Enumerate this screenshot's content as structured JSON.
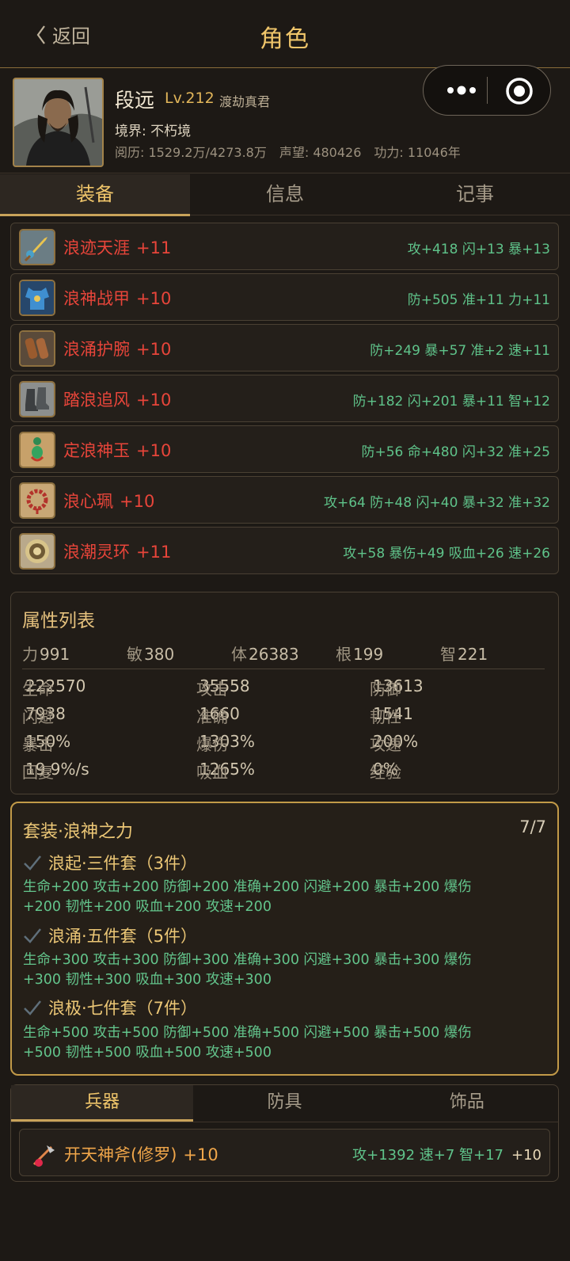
{
  "nav": {
    "back": "返回",
    "title": "角色"
  },
  "profile": {
    "name": "段远",
    "level": "Lv.212",
    "rank": "渡劫真君",
    "realm": "境界: 不朽境",
    "experience": "阅历: 1529.2万/4273.8万",
    "reputation": "声望: 480426",
    "power": "功力: 11046年"
  },
  "tabs": [
    "装备",
    "信息",
    "记事"
  ],
  "equipment": [
    {
      "name": "浪迹天涯",
      "plus": "+11",
      "attrs": "攻+418 闪+13 暴+13",
      "icon": "sword-icon"
    },
    {
      "name": "浪神战甲",
      "plus": "+10",
      "attrs": "防+505 准+11 力+11",
      "icon": "armor-icon"
    },
    {
      "name": "浪涌护腕",
      "plus": "+10",
      "attrs": "防+249 暴+57 准+2 速+11",
      "icon": "bracer-icon"
    },
    {
      "name": "踏浪追风",
      "plus": "+10",
      "attrs": "防+182 闪+201 暴+11 智+12",
      "icon": "boots-icon"
    },
    {
      "name": "定浪神玉",
      "plus": "+10",
      "attrs": "防+56 命+480 闪+32 准+25",
      "icon": "jade-pendant-icon"
    },
    {
      "name": "浪心珮",
      "plus": "+10",
      "attrs": "攻+64 防+48 闪+40 暴+32 准+32",
      "icon": "bead-necklace-icon"
    },
    {
      "name": "浪潮灵环",
      "plus": "+11",
      "attrs": "攻+58 暴伤+49 吸血+26 速+26",
      "icon": "ring-icon"
    }
  ],
  "attributes": {
    "title": "属性列表",
    "primary": [
      {
        "label": "力",
        "value": "991"
      },
      {
        "label": "敏",
        "value": "380"
      },
      {
        "label": "体",
        "value": "26383"
      },
      {
        "label": "根",
        "value": "199"
      },
      {
        "label": "智",
        "value": "221"
      }
    ],
    "secondary": [
      {
        "label": "生命",
        "value": "222570"
      },
      {
        "label": "攻击",
        "value": "35558"
      },
      {
        "label": "防御",
        "value": "13613"
      },
      {
        "label": "闪避",
        "value": "7938"
      },
      {
        "label": "准确",
        "value": "1660"
      },
      {
        "label": "韧性",
        "value": "1541"
      },
      {
        "label": "暴击",
        "value": "150%"
      },
      {
        "label": "爆伤",
        "value": "1303%"
      },
      {
        "label": "攻速",
        "value": "200%"
      },
      {
        "label": "回复",
        "value": "19.9%/s"
      },
      {
        "label": "吸血",
        "value": "1265%"
      },
      {
        "label": "经验",
        "value": "0%"
      }
    ]
  },
  "set": {
    "title": "套装·浪神之力",
    "count": "7/7",
    "tiers": [
      {
        "name": "浪起·三件套（3件）",
        "effects": "生命+200  攻击+200  防御+200  准确+200  闪避+200  暴击+200  爆伤+200  韧性+200  吸血+200  攻速+200"
      },
      {
        "name": "浪涌·五件套（5件）",
        "effects": "生命+300  攻击+300  防御+300  准确+300  闪避+300  暴击+300  爆伤+300  韧性+300  吸血+300  攻速+300"
      },
      {
        "name": "浪极·七件套（7件）",
        "effects": "生命+500  攻击+500  防御+500  准确+500  闪避+500  暴击+500  爆伤+500  韧性+500  吸血+500  攻速+500"
      }
    ]
  },
  "subtabs": [
    "兵器",
    "防具",
    "饰品"
  ],
  "weapon": {
    "name": "开天神斧(修罗)",
    "plus": "+10",
    "attrs": "攻+1392 速+7 智+17",
    "extra": "+10"
  },
  "colors": {
    "accent": "#efc56a",
    "item_name": "#e8453a",
    "bonus": "#5fc38a",
    "background": "#1d1915"
  }
}
